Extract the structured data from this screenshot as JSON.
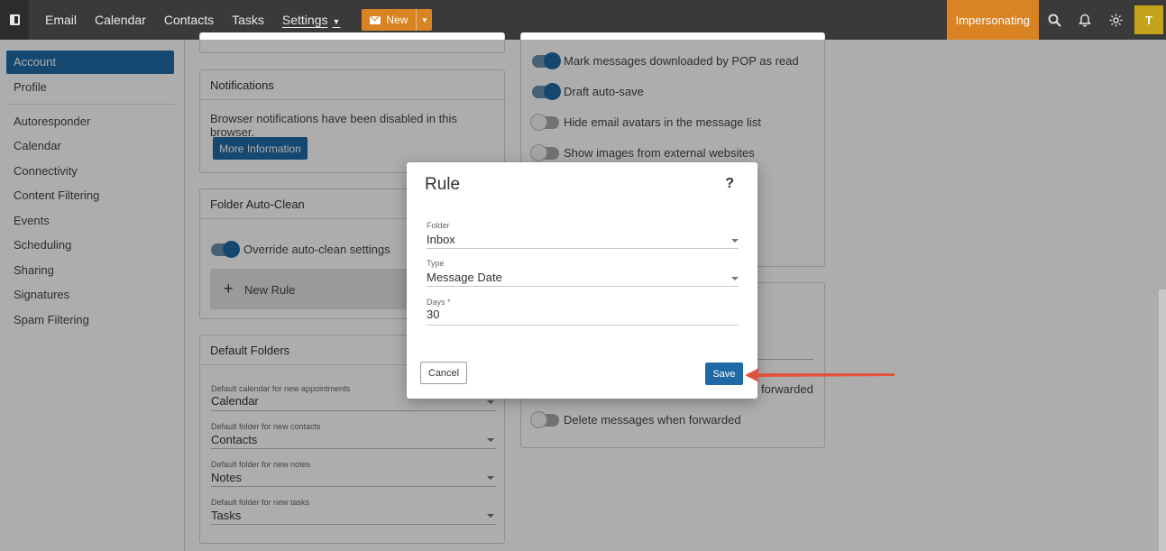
{
  "topbar": {
    "nav": [
      "Email",
      "Calendar",
      "Contacts",
      "Tasks"
    ],
    "settings_label": "Settings",
    "new_label": "New",
    "impersonating_label": "Impersonating",
    "avatar_initial": "T",
    "accent": "#d98322",
    "background": "#3a3a3a"
  },
  "sidebar": {
    "items": [
      "Account",
      "Profile",
      "Autoresponder",
      "Calendar",
      "Connectivity",
      "Content Filtering",
      "Events",
      "Scheduling",
      "Sharing",
      "Signatures",
      "Spam Filtering"
    ],
    "active": "Account",
    "active_color": "#1f6aa6"
  },
  "notifications": {
    "title": "Notifications",
    "text": "Browser notifications have been disabled in this browser.",
    "button": "More Information"
  },
  "folder_autoclean": {
    "title": "Folder Auto-Clean",
    "override_label": "Override auto-clean settings",
    "override_on": true,
    "new_rule_label": "New Rule"
  },
  "default_folders": {
    "title": "Default Folders",
    "fields": [
      {
        "label": "Default calendar for new appointments",
        "value": "Calendar"
      },
      {
        "label": "Default folder for new contacts",
        "value": "Contacts"
      },
      {
        "label": "Default folder for new notes",
        "value": "Notes"
      },
      {
        "label": "Default folder for new tasks",
        "value": "Tasks"
      }
    ]
  },
  "email_options": [
    {
      "label": "Mark messages downloaded by POP as read",
      "on": true
    },
    {
      "label": "Draft auto-save",
      "on": true
    },
    {
      "label": "Hide email avatars in the message list",
      "on": false
    },
    {
      "label": "Show images from external websites",
      "on": false
    }
  ],
  "forwarding": {
    "partial_label": "forwarded",
    "delete_label": "Delete messages when forwarded"
  },
  "dialog": {
    "title": "Rule",
    "help": "?",
    "folder_label": "Folder",
    "folder_value": "Inbox",
    "type_label": "Type",
    "type_value": "Message Date",
    "days_label": "Days *",
    "days_value": "30",
    "cancel": "Cancel",
    "save": "Save"
  },
  "annotation_color": "#e0523a"
}
